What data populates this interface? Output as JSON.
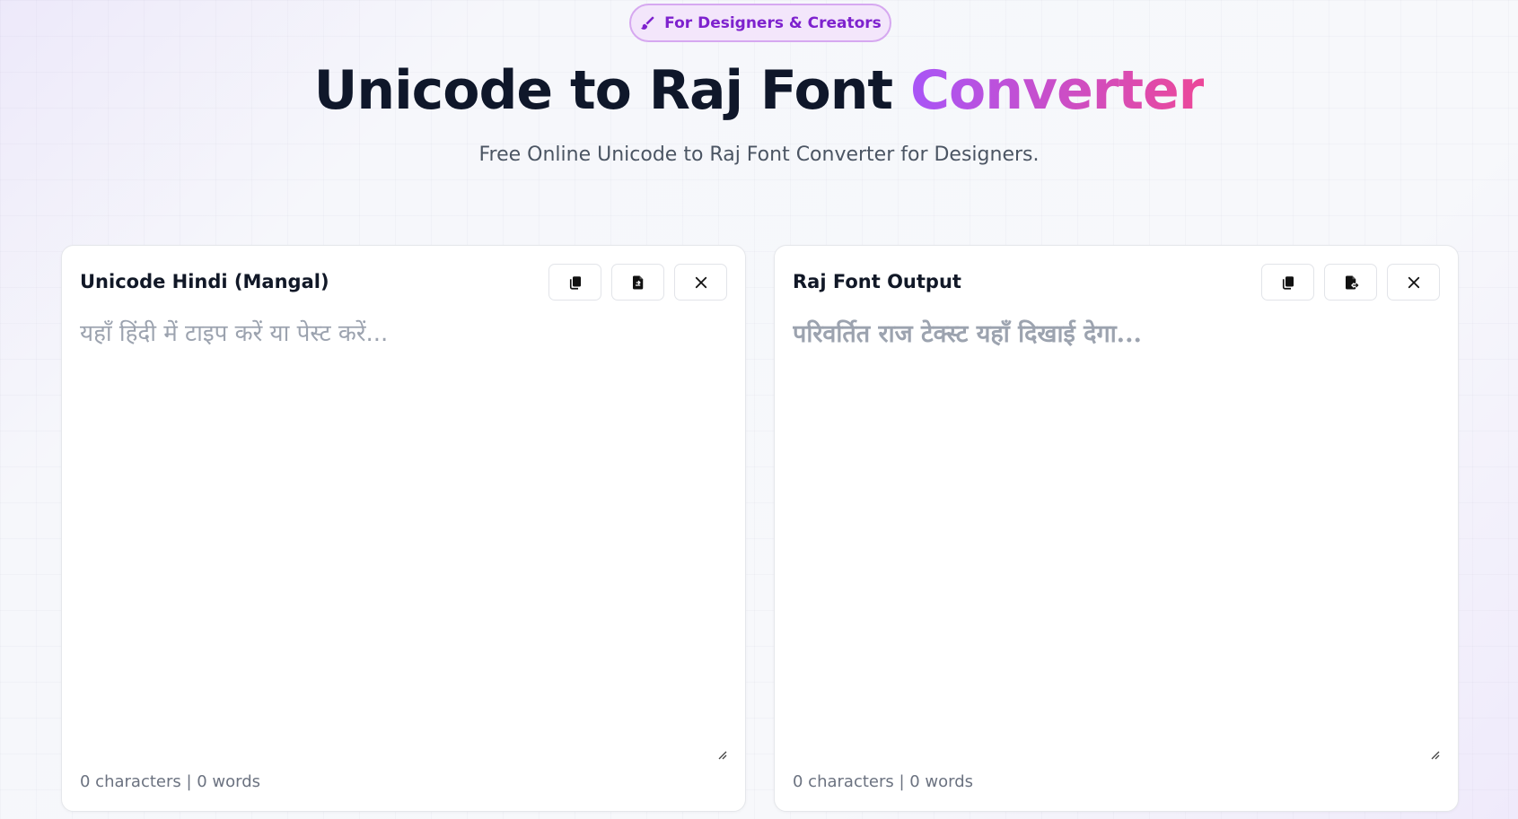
{
  "badge": {
    "icon": "paint-brush-icon",
    "label": "For Designers & Creators"
  },
  "hero": {
    "title_main": "Unicode to Raj Font ",
    "title_accent": "Converter",
    "subtitle": "Free Online Unicode to Raj Font Converter for Designers."
  },
  "colors": {
    "accent_start": "#a855f7",
    "accent_end": "#ec4899",
    "badge_text": "#7e22ce"
  },
  "input_panel": {
    "title": "Unicode Hindi (Mangal)",
    "placeholder": "यहाँ हिंदी में टाइप करें या पेस्ट करें...",
    "value": "",
    "counter": "0 characters | 0 words",
    "actions": [
      "copy-icon",
      "paste-file-icon",
      "close-icon"
    ]
  },
  "output_panel": {
    "title": "Raj Font Output",
    "placeholder": "परिवर्तित राज टेक्स्ट यहाँ दिखाई देगा...",
    "value": "",
    "counter": "0 characters | 0 words",
    "actions": [
      "copy-icon",
      "export-file-icon",
      "close-icon"
    ]
  }
}
